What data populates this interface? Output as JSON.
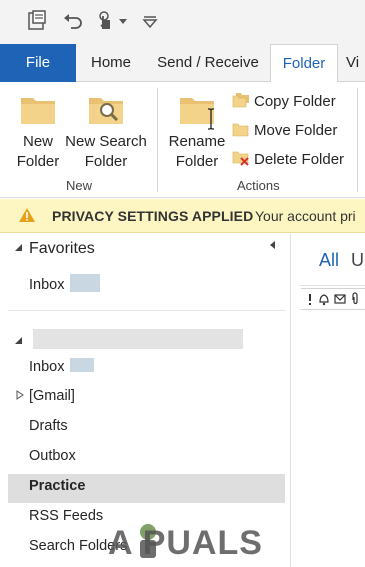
{
  "quick_access": {
    "icons": [
      "outlook-app-icon",
      "undo-icon",
      "touch-mode-icon",
      "dropdown-arrow-icon",
      "customize-toolbar-icon"
    ]
  },
  "tabs": [
    {
      "label": "File"
    },
    {
      "label": "Home"
    },
    {
      "label": "Send / Receive"
    },
    {
      "label": "Folder"
    },
    {
      "label": "Vi"
    }
  ],
  "ribbon": {
    "new_group": {
      "label": "New",
      "new_folder": {
        "line1": "New",
        "line2": "Folder"
      },
      "new_search_folder": {
        "line1": "New Search",
        "line2": "Folder"
      }
    },
    "actions_group": {
      "label": "Actions",
      "rename_folder": {
        "line1": "Rename",
        "line2": "Folder"
      },
      "copy_folder": "Copy Folder",
      "move_folder": "Move Folder",
      "delete_folder": "Delete Folder"
    }
  },
  "banner": {
    "title": "PRIVACY SETTINGS APPLIED",
    "message": "Your account pri"
  },
  "folder_pane": {
    "favorites_label": "Favorites",
    "favorites": [
      {
        "label": "Inbox"
      }
    ],
    "account_folders": [
      {
        "label": "Inbox"
      },
      {
        "label": "[Gmail]"
      },
      {
        "label": "Drafts"
      },
      {
        "label": "Outbox"
      },
      {
        "label": "Practice",
        "selected": true
      },
      {
        "label": "RSS Feeds"
      },
      {
        "label": "Search Folders"
      }
    ]
  },
  "message_list": {
    "filter_all": "All",
    "filter_unread": "U"
  },
  "watermark": {
    "text": "A  PUALS"
  },
  "colors": {
    "accent": "#1e63b6",
    "banner_bg": "#fdf6c3",
    "selected_row": "#dedede"
  }
}
